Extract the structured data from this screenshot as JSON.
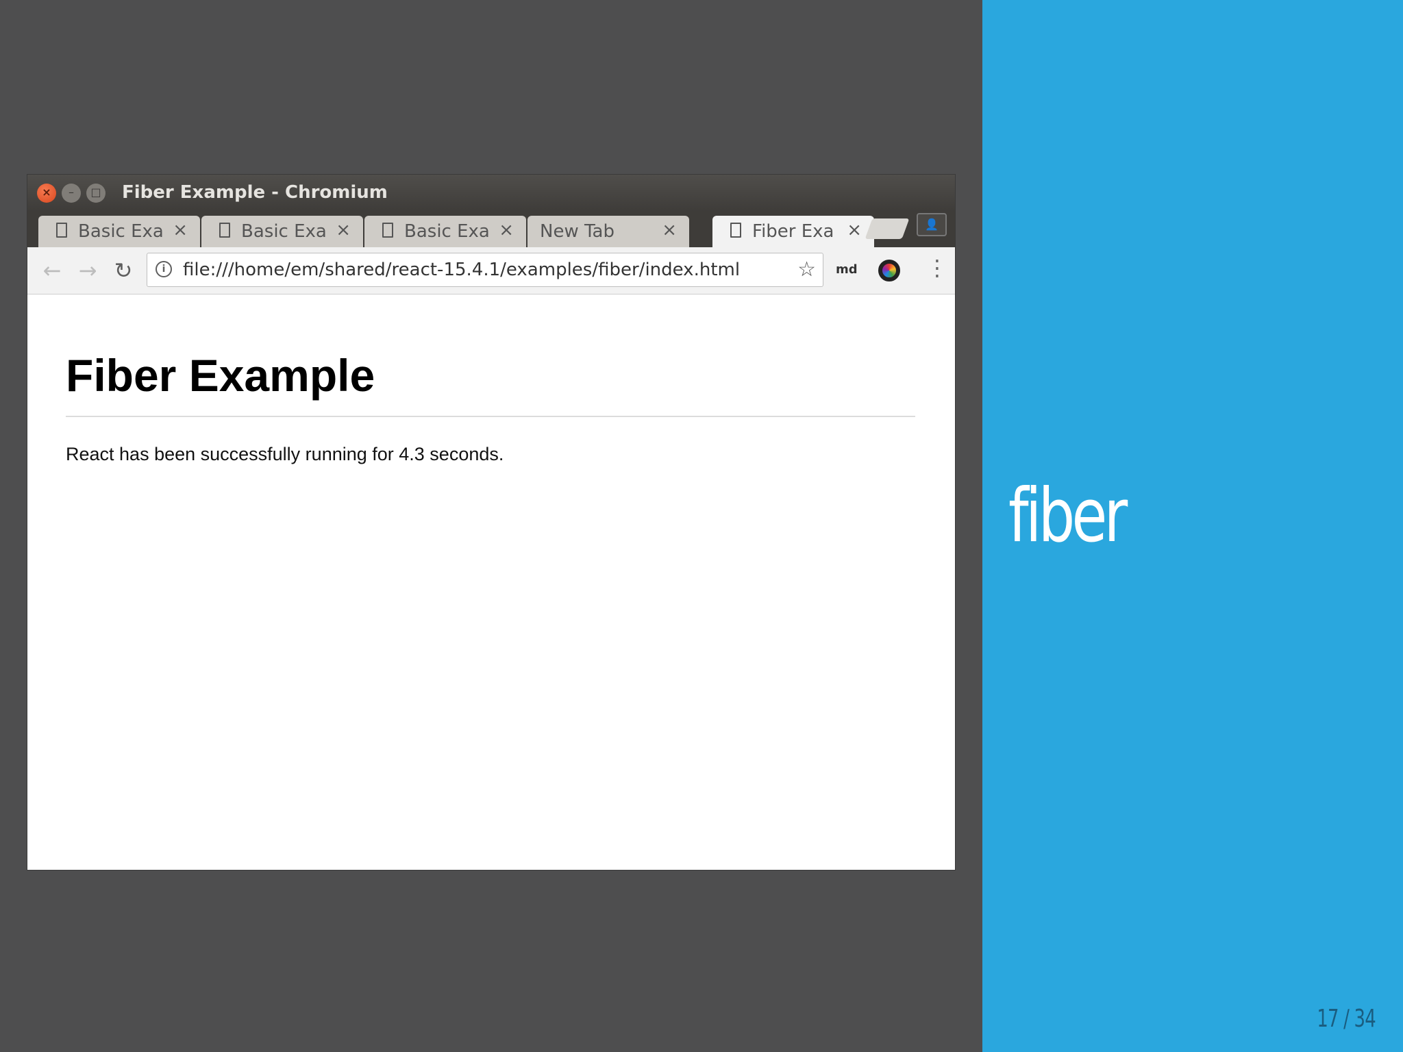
{
  "window": {
    "title": "Fiber Example - Chromium",
    "close_glyph": "×",
    "min_glyph": "–",
    "max_glyph": "□"
  },
  "tabs": [
    {
      "label": "Basic Exa",
      "close": "×",
      "active": false
    },
    {
      "label": "Basic Exa",
      "close": "×",
      "active": false
    },
    {
      "label": "Basic Exa",
      "close": "×",
      "active": false
    },
    {
      "label": "New Tab",
      "close": "×",
      "active": false
    },
    {
      "label": "Fiber Exa",
      "close": "×",
      "active": true
    }
  ],
  "toolbar": {
    "back_glyph": "←",
    "forward_glyph": "→",
    "reload_glyph": "↻",
    "info_glyph": "i",
    "url": "file:///home/em/shared/react-15.4.1/examples/fiber/index.html",
    "star_glyph": "☆",
    "extension_label": "md",
    "menu_glyph": "⋮",
    "profile_glyph": "👤"
  },
  "page": {
    "heading": "Fiber Example",
    "message": "React has been successfully running for 4.3 seconds."
  },
  "slide": {
    "title": "fiber",
    "counter": "17 / 34"
  },
  "colors": {
    "slide_accent": "#2aa7de",
    "slide_background": "#4e4e4f",
    "close_button": "#e0542a"
  }
}
